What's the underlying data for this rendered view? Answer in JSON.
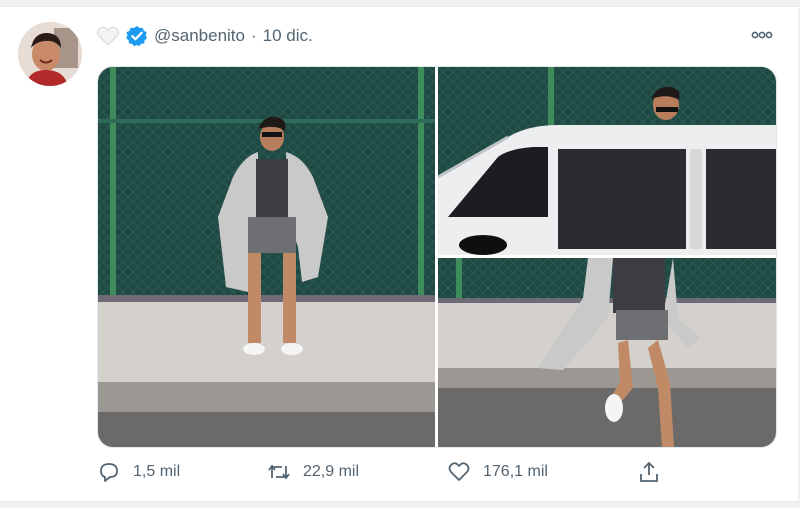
{
  "tweet": {
    "handle": "@sanbenito",
    "separator": "·",
    "date": "10 dic."
  },
  "icons": {
    "avatar": "avatar",
    "emoji": "white-heart-emoji-icon",
    "verified": "verified-badge-icon",
    "more": "more-options-icon",
    "reply": "reply-icon",
    "retweet": "retweet-icon",
    "like": "like-icon",
    "share": "share-icon"
  },
  "actions": {
    "replies": "1,5 mil",
    "retweets": "22,9 mil",
    "likes": "176,1 mil"
  },
  "media": {
    "photos": [
      "photo-standing-robe",
      "photo-car-window",
      "photo-stepping-street"
    ]
  },
  "colors": {
    "verified": "#1d9bf0",
    "secondary_text": "#536471",
    "fence": "#1f4a44"
  }
}
